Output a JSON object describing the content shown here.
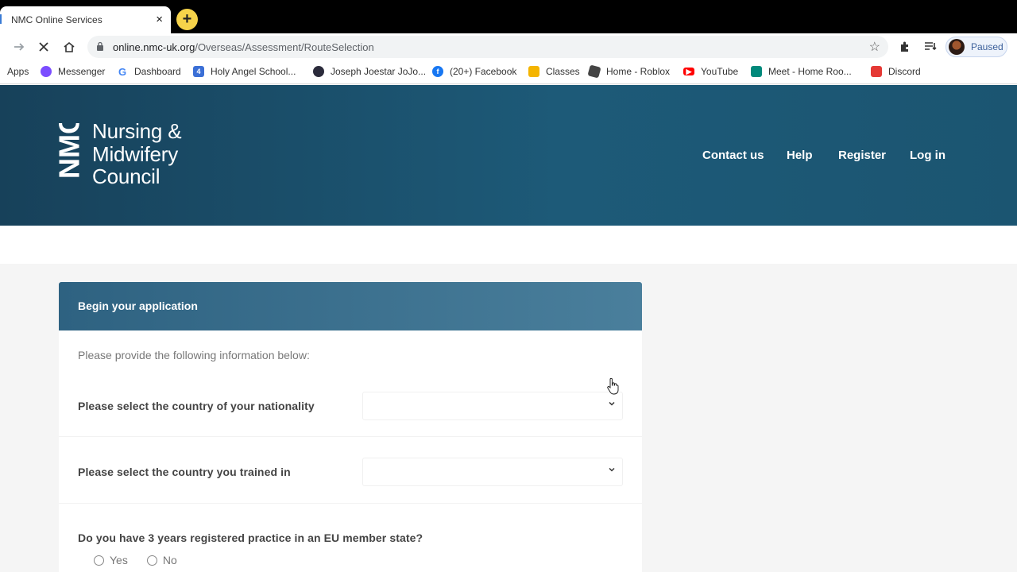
{
  "browser": {
    "tab_title": "NMC Online Services",
    "tab_close": "×",
    "new_tab": "+",
    "url_host": "online.nmc-uk.org",
    "url_path": "/Overseas/Assessment/RouteSelection",
    "profile_status": "Paused",
    "icons": [
      "forward-arrow-icon",
      "stop-loading-icon",
      "home-icon",
      "lock-icon",
      "star-icon",
      "extensions-icon",
      "reading-list-icon",
      "avatar"
    ]
  },
  "bookmarks": [
    {
      "label": "Apps",
      "icon": "apps-icon",
      "color": "#4285f4"
    },
    {
      "label": "Messenger",
      "icon": "messenger-icon",
      "color": "#7b4dff"
    },
    {
      "label": "Dashboard",
      "icon": "google-icon",
      "color": "#4285f4"
    },
    {
      "label": "Holy Angel School...",
      "icon": "school-icon",
      "color": "#3b6fd6"
    },
    {
      "label": "Joseph Joestar JoJo...",
      "icon": "jojo-icon",
      "color": "#2b2b3b"
    },
    {
      "label": "(20+) Facebook",
      "icon": "facebook-icon",
      "color": "#1877f2"
    },
    {
      "label": "Classes",
      "icon": "classroom-icon",
      "color": "#f4b400"
    },
    {
      "label": "Home - Roblox",
      "icon": "roblox-icon",
      "color": "#444444"
    },
    {
      "label": "YouTube",
      "icon": "youtube-icon",
      "color": "#ff0000"
    },
    {
      "label": "Meet - Home Roo...",
      "icon": "meet-icon",
      "color": "#00897b"
    },
    {
      "label": "Discord",
      "icon": "discord-icon",
      "color": "#e53935"
    }
  ],
  "site": {
    "logo_mark": "NMC",
    "logo_lines": [
      "Nursing &",
      "Midwifery",
      "Council"
    ],
    "nav": [
      "Contact us",
      "Help",
      "Register",
      "Log in"
    ]
  },
  "form": {
    "heading": "Begin your application",
    "intro": "Please provide the following information below:",
    "q_nationality": "Please select the country of your nationality",
    "q_trained": "Please select the country you trained in",
    "q_eu_practice": "Do you have 3 years registered practice in an EU member state?",
    "opt_yes": "Yes",
    "opt_no": "No",
    "nationality_value": "",
    "trained_value": ""
  },
  "colors": {
    "header": "#1d5a78",
    "card_head": "#3a7090",
    "tab_accent": "#f6d34a"
  }
}
